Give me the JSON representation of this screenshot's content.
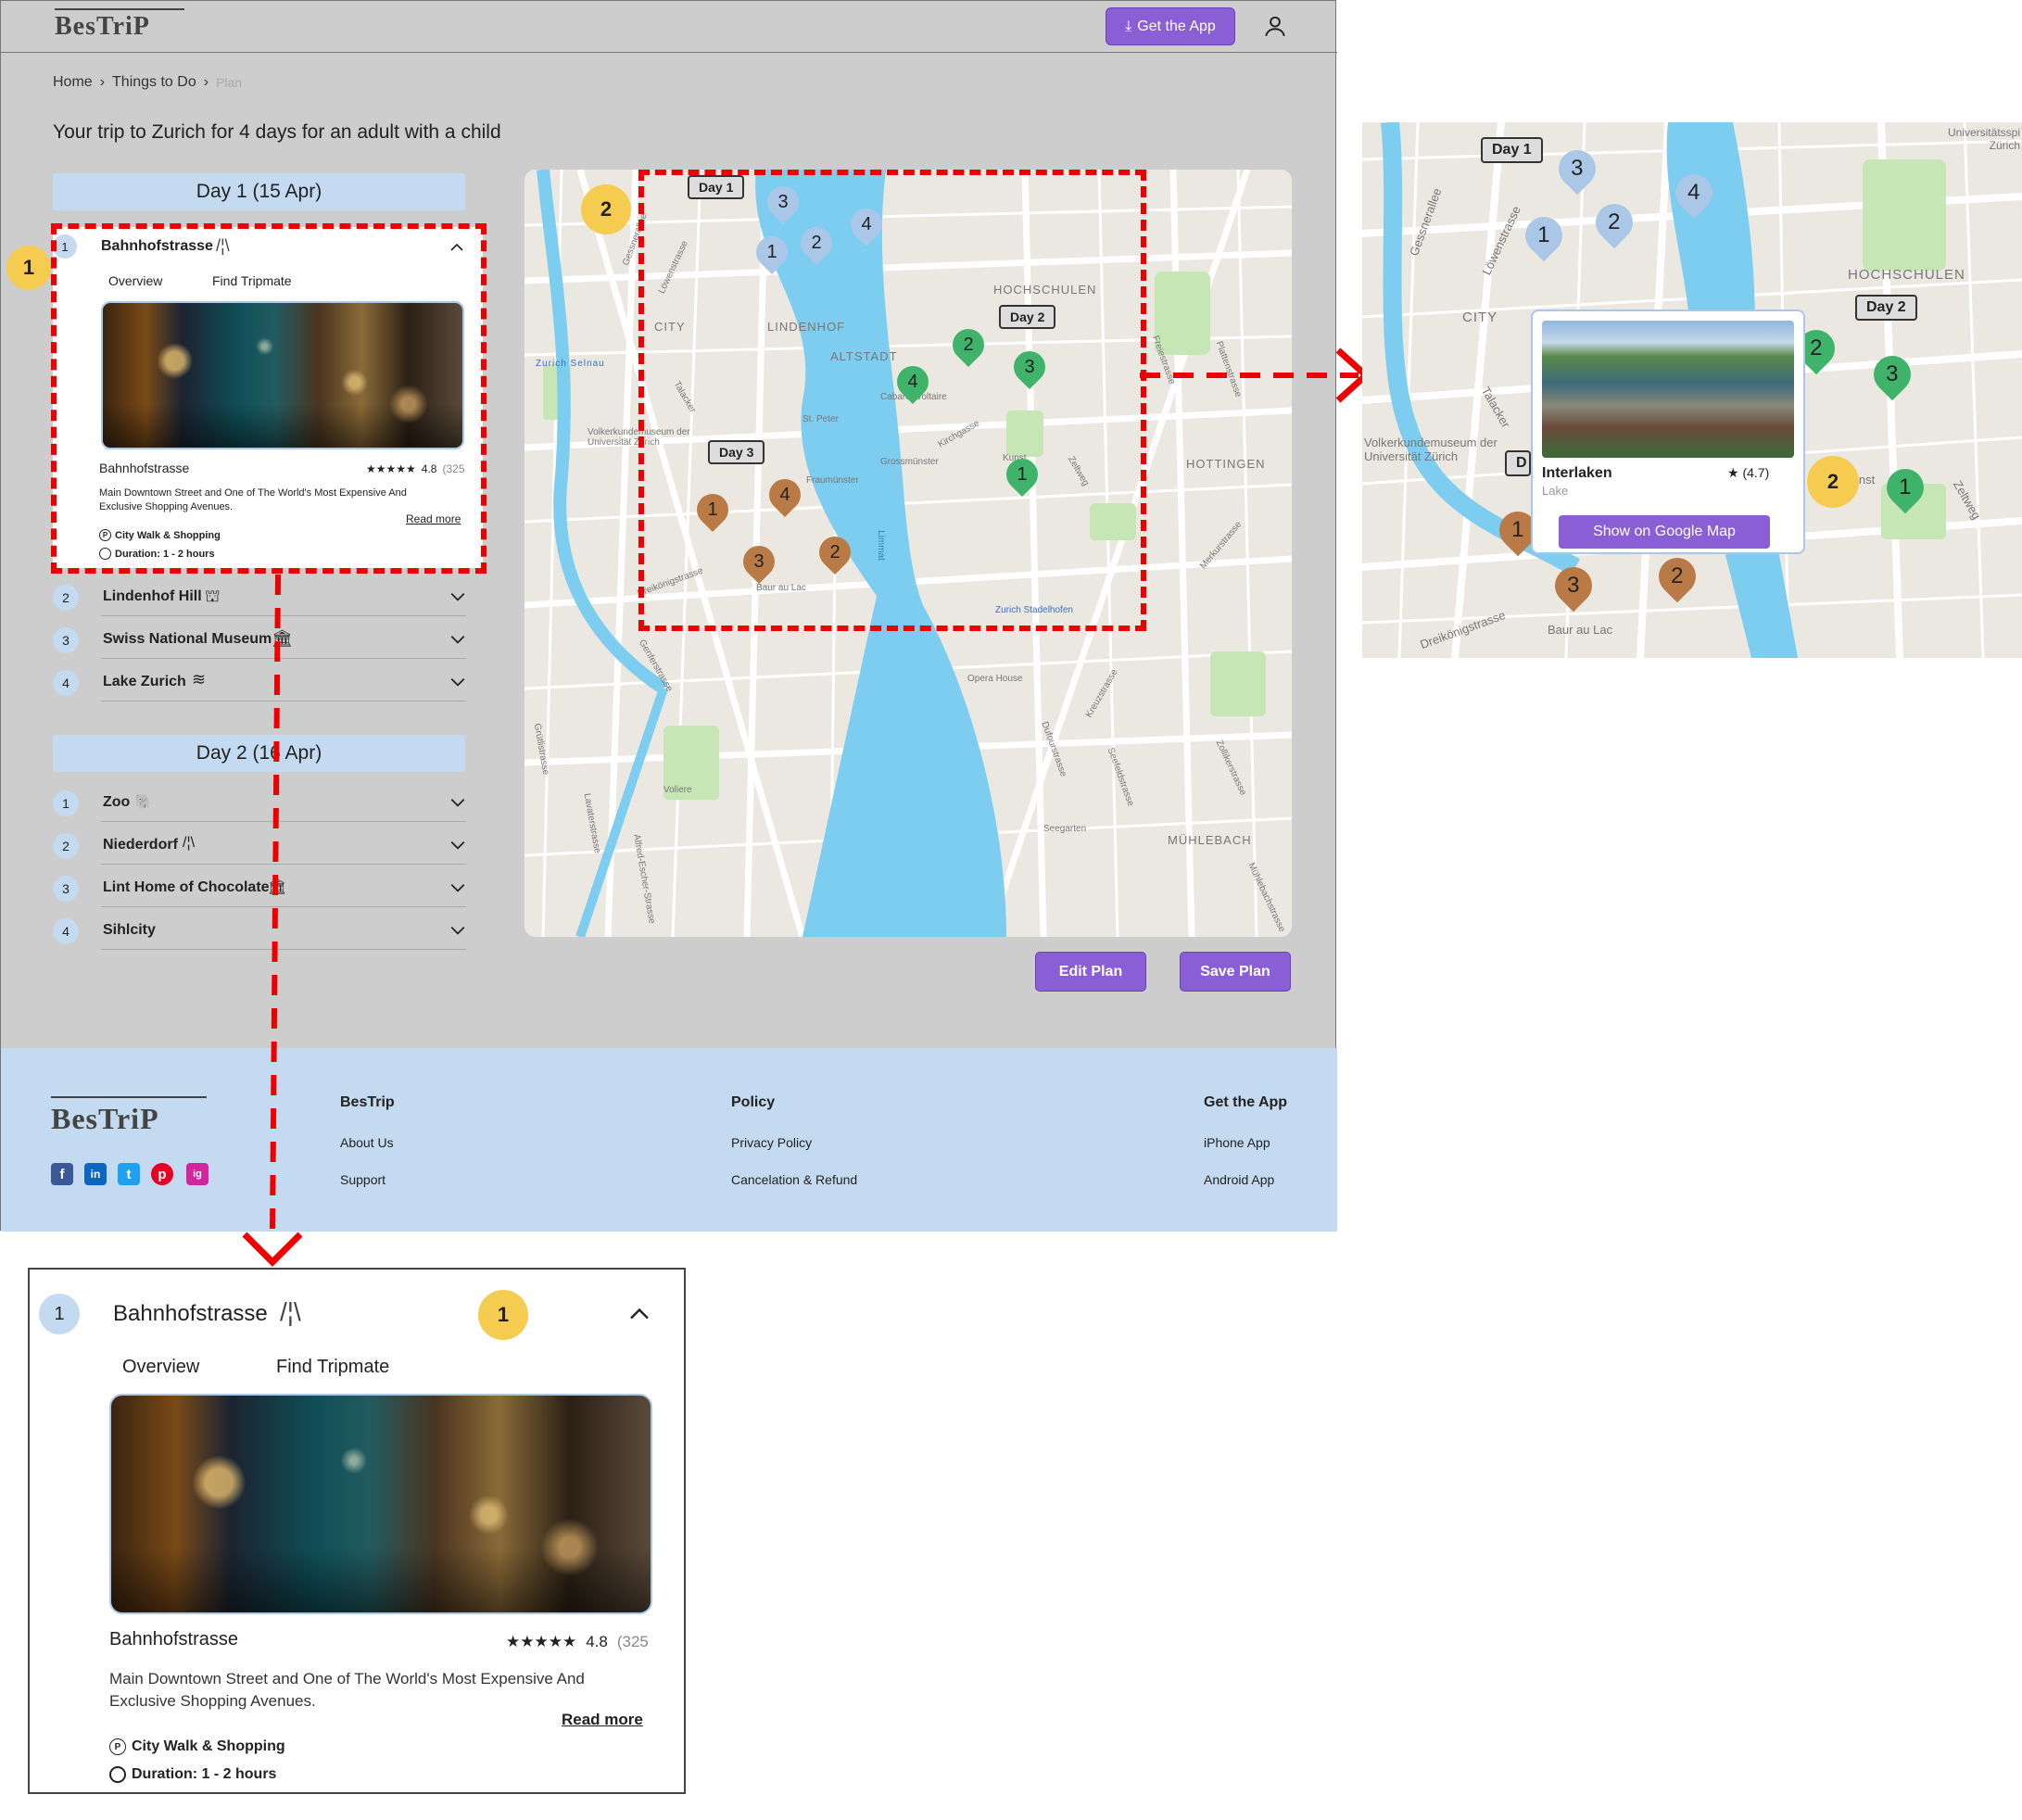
{
  "header": {
    "logo": "BesTriP",
    "get_app_label": "Get the App"
  },
  "breadcrumb": {
    "home": "Home",
    "things": "Things to Do",
    "plan": "Plan"
  },
  "page_title": "Your trip to Zurich for 4 days for an adult with a child",
  "day1": {
    "title": "Day 1 (15 Apr)",
    "items": [
      {
        "num": "1",
        "label": "Bahnhofstrasse"
      },
      {
        "num": "2",
        "label": "Lindenhof Hill"
      },
      {
        "num": "3",
        "label": "Swiss National Museum"
      },
      {
        "num": "4",
        "label": "Lake Zurich"
      }
    ]
  },
  "day2": {
    "title": "Day 2 (16 Apr)",
    "items": [
      {
        "num": "1",
        "label": "Zoo"
      },
      {
        "num": "2",
        "label": "Niederdorf"
      },
      {
        "num": "3",
        "label": "Lint Home of Chocolate"
      },
      {
        "num": "4",
        "label": "Sihlcity"
      }
    ]
  },
  "detail": {
    "tab_overview": "Overview",
    "tab_tripmate": "Find Tripmate",
    "name": "Bahnhofstrasse",
    "stars": "★★★★★",
    "rating": "4.8",
    "reviews": "(325",
    "description": "Main Downtown Street and One of The World's Most Expensive And Exclusive Shopping Avenues.",
    "read_more": "Read more",
    "category": "City Walk & Shopping",
    "duration": "Duration: 1 - 2 hours"
  },
  "annotations": {
    "badge1": "1",
    "badge2": "2"
  },
  "map": {
    "day_labels": [
      "Day 1",
      "Day 2",
      "Day 3"
    ],
    "districts": [
      "CITY",
      "LINDENHOF",
      "ALTSTADT",
      "HOCHSCHULEN",
      "HOTTINGEN",
      "MÜHLEBACH"
    ],
    "places": [
      "Zurich Selnau",
      "Volkerkundemuseum der Universität Zürich",
      "St. Peter",
      "Fraumünster",
      "Grossmünster",
      "Cabaret Voltaire",
      "Baur au Lac",
      "Zurich Stadelhofen",
      "Opera House",
      "Seegarten",
      "Voliere",
      "Kunst",
      "Limmat"
    ],
    "streets": [
      "Gessnerallee",
      "Löwenstrasse",
      "Talacker",
      "Dreikönigstrasse",
      "Genferstrasse",
      "Freiestrasse",
      "Plattenstrasse",
      "Zeltweg",
      "Kirchgasse",
      "Merkurstrasse",
      "Kreuzstrasse",
      "Dufourstrasse",
      "Seefeldstrasse",
      "Zollikerstrasse",
      "Mühlebachstrasse",
      "Alfred-Escher-Strasse",
      "Lavaterstrasse",
      "Grütlistrasse"
    ],
    "edit_plan": "Edit Plan",
    "save_plan": "Save Plan"
  },
  "popup": {
    "name": "Interlaken",
    "type": "Lake",
    "rating": "★ (4.7)",
    "button": "Show on Google Map",
    "zoom_corner": "Universitätsspi Zürich",
    "zoom_truncated": "D"
  },
  "footer": {
    "logo": "BesTriP",
    "col1": {
      "title": "BesTrip",
      "links": [
        "About Us",
        "Support"
      ]
    },
    "col2": {
      "title": "Policy",
      "links": [
        "Privacy Policy",
        "Cancelation & Refund"
      ]
    },
    "col3": {
      "title": "Get the App",
      "links": [
        "iPhone App",
        "Android App"
      ]
    },
    "social": [
      "f",
      "in",
      "t",
      "p",
      "ig"
    ]
  },
  "colors": {
    "accent": "#8a5fd6",
    "light_blue": "#c3daf0",
    "pin_blue": "#aac7e8",
    "pin_green": "#3fb36a",
    "pin_brown": "#b97a45",
    "badge": "#f5cc50",
    "water": "#7ccdf0"
  }
}
